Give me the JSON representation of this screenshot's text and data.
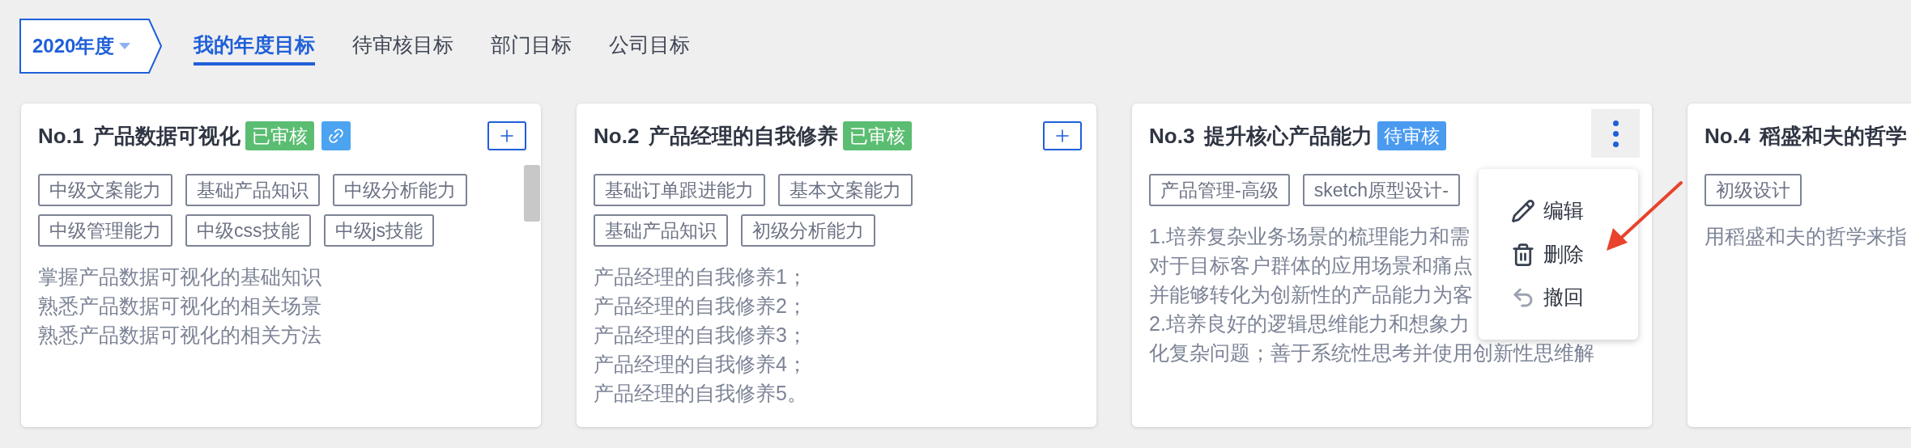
{
  "year_selector": {
    "label": "2020年度"
  },
  "tabs": [
    {
      "label": "我的年度目标",
      "selected": true
    },
    {
      "label": "待审核目标",
      "selected": false
    },
    {
      "label": "部门目标",
      "selected": false
    },
    {
      "label": "公司目标",
      "selected": false
    }
  ],
  "cards": [
    {
      "number": "No.1",
      "title": "产品数据可视化",
      "status": {
        "label": "已审核",
        "kind": "approved"
      },
      "linked": true,
      "header_button": {
        "kind": "add"
      },
      "scrollbar": true,
      "tags": [
        "中级文案能力",
        "基础产品知识",
        "中级分析能力",
        "中级管理能力",
        "中级css技能",
        "中级js技能"
      ],
      "lines": [
        "掌握产品数据可视化的基础知识",
        "熟悉产品数据可视化的相关场景",
        "熟悉产品数据可视化的相关方法"
      ]
    },
    {
      "number": "No.2",
      "title": "产品经理的自我修养",
      "status": {
        "label": "已审核",
        "kind": "approved"
      },
      "header_button": {
        "kind": "add"
      },
      "tags": [
        "基础订单跟进能力",
        "基本文案能力",
        "基础产品知识",
        "初级分析能力"
      ],
      "lines": [
        "产品经理的自我修养1；",
        "产品经理的自我修养2；",
        "产品经理的自我修养3；",
        "产品经理的自我修养4；",
        "产品经理的自我修养5。"
      ]
    },
    {
      "number": "No.3",
      "title": "提升核心产品能力",
      "status": {
        "label": "待审核",
        "kind": "pending"
      },
      "header_button": {
        "kind": "more"
      },
      "menu": {
        "items": [
          {
            "label": "编辑",
            "kind": "edit"
          },
          {
            "label": "删除",
            "kind": "delete"
          },
          {
            "label": "撤回",
            "kind": "revoke"
          }
        ]
      },
      "tags": [
        "产品管理-高级",
        "sketch原型设计-"
      ],
      "lines": [
        "1.培养复杂业务场景的梳理能力和需",
        "对于目标客户群体的应用场景和痛点",
        "并能够转化为创新性的产品能力为客",
        "2.培养良好的逻辑思维能力和想象力",
        "化复杂问题；善于系统性思考并使用创新性思维解"
      ]
    },
    {
      "number": "No.4",
      "title": "稻盛和夫的哲学",
      "tags": [
        "初级设计"
      ],
      "lines": [
        "用稻盛和夫的哲学来指"
      ]
    }
  ]
}
